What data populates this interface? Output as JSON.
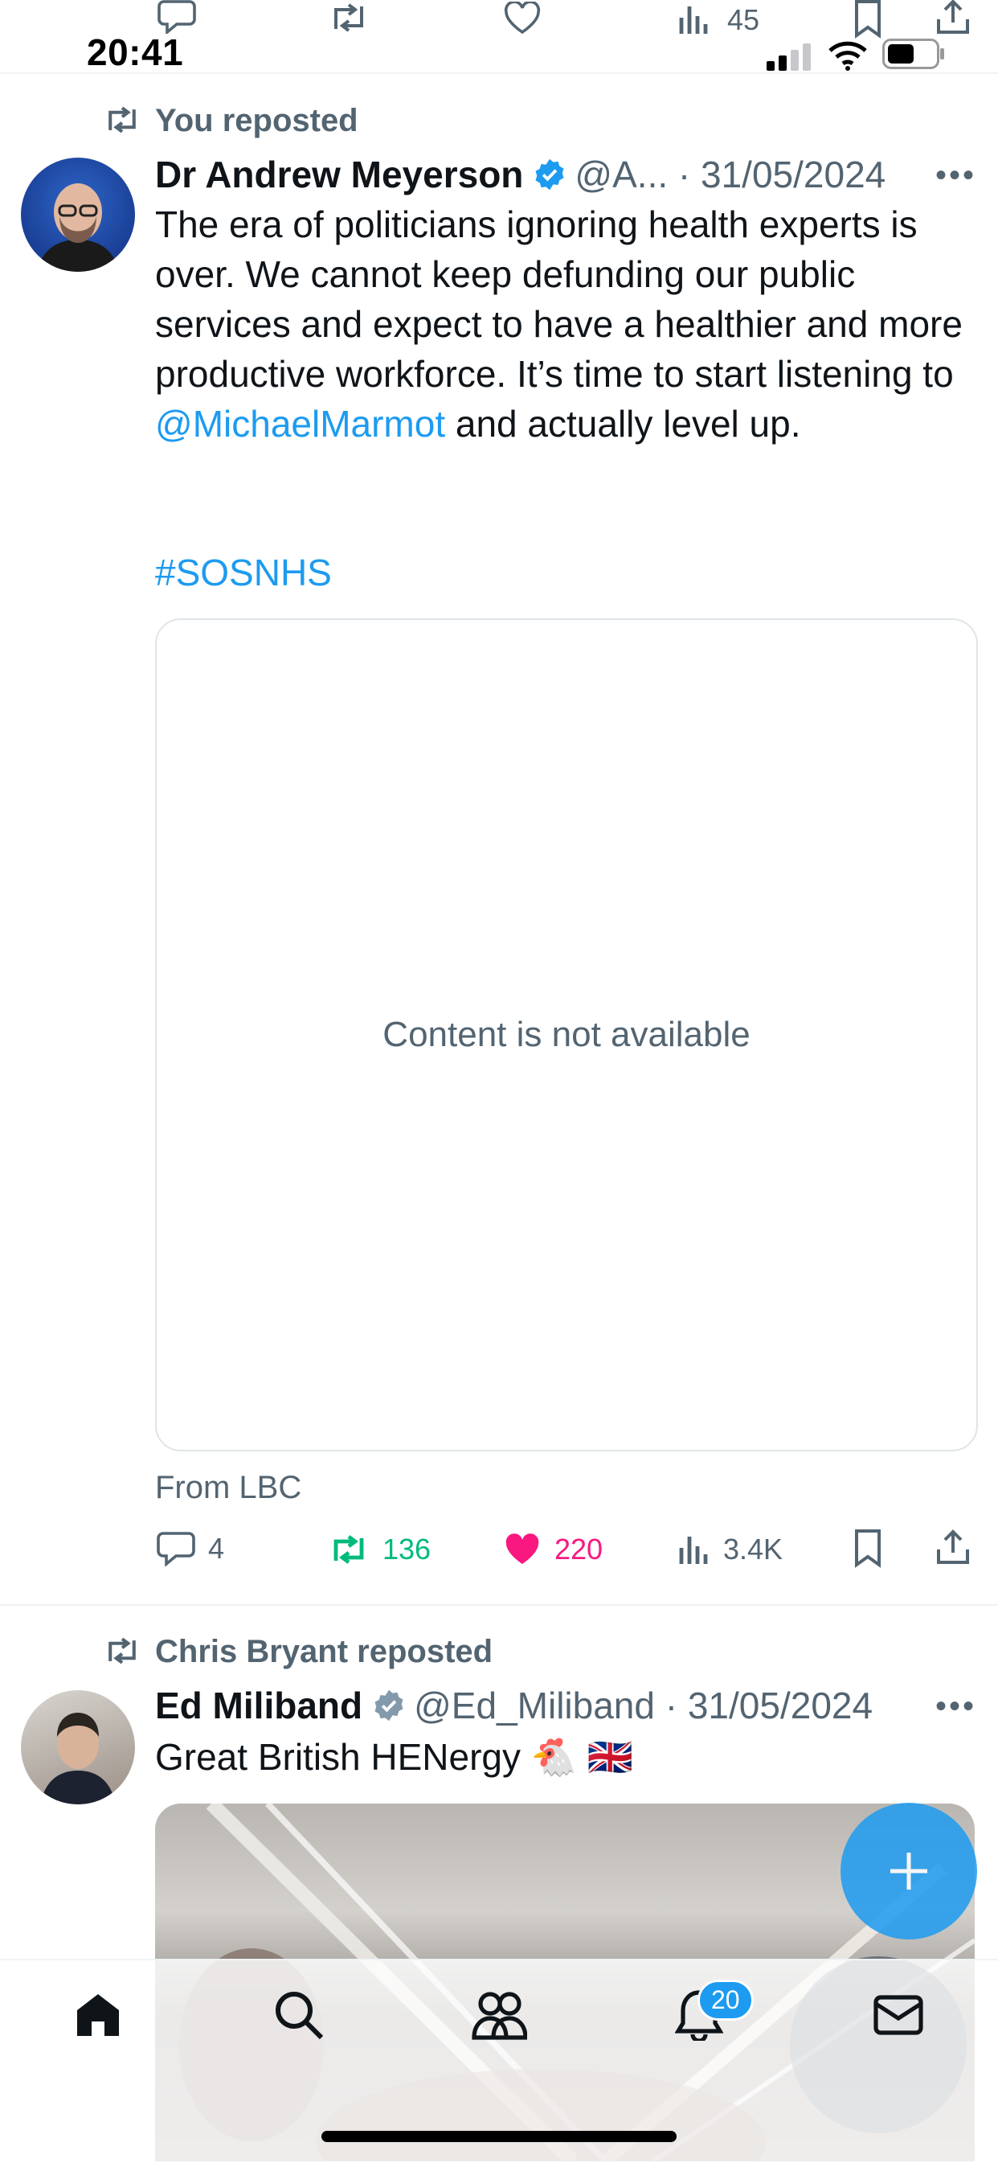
{
  "status_bar": {
    "time": "20:41"
  },
  "top_action_row": {
    "views_count": "45"
  },
  "tweets": [
    {
      "repost_label": "You reposted",
      "author_name": "Dr Andrew Meyerson",
      "handle_date": "@A... · 31/05/2024",
      "text_part1": "The era of politicians ignoring health experts is over. We cannot keep defunding our public services and expect to have a healthier and more productive workforce. It’s time to start listening to ",
      "mention": "@MichaelMarmot",
      "text_part2": " and actually level up.",
      "hashtag": "#SOSNHS",
      "media_message": "Content is not available",
      "source": "From LBC",
      "replies": "4",
      "reposts": "136",
      "likes": "220",
      "views": "3.4K"
    },
    {
      "repost_label": "Chris Bryant reposted",
      "author_name": "Ed Miliband",
      "handle_date": "@Ed_Miliband · 31/05/2024",
      "text": "Great British HENergy 🐔 🇬🇧"
    }
  ],
  "nav": {
    "notifications_badge": "20"
  },
  "colors": {
    "accent": "#1d9bf0",
    "repost_active": "#00ba7c",
    "like_active": "#f91880",
    "secondary_text": "#536471"
  }
}
